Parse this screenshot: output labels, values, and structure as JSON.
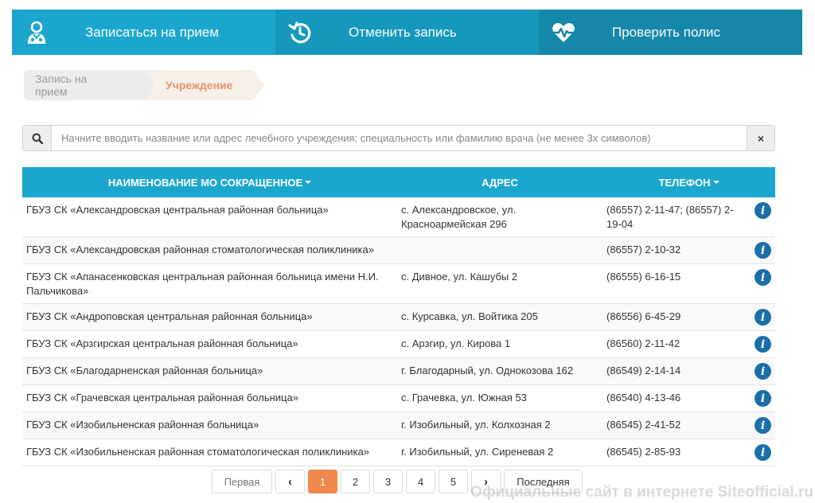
{
  "nav": {
    "tabs": [
      {
        "label": "Записаться на прием",
        "icon": "doctor-icon"
      },
      {
        "label": "Отменить запись",
        "icon": "undo-clock-icon"
      },
      {
        "label": "Проверить полис",
        "icon": "heart-pulse-icon"
      }
    ]
  },
  "breadcrumb": {
    "step1": "Запись на прием",
    "step2": "Учреждение"
  },
  "search": {
    "placeholder": "Начните вводить название или адрес лечебного учреждения; специальность или фамилию врача (не менее 3х символов)",
    "clear_label": "×"
  },
  "table": {
    "headers": {
      "name": "НАИМЕНОВАНИЕ МО СОКРАЩЕННОЕ",
      "address": "АДРЕС",
      "phone": "ТЕЛЕФОН"
    },
    "rows": [
      {
        "name": "ГБУЗ СК «Александровская центральная районная больница»",
        "address": "с. Александровское, ул. Красноармейская 296",
        "phone": "(86557) 2-11-47; (86557) 2-19-04"
      },
      {
        "name": "ГБУЗ СК «Александровская районная стоматологическая поликлиника»",
        "address": "",
        "phone": "(86557) 2-10-32"
      },
      {
        "name": "ГБУЗ СК «Апанасенковская центральная районная больница имени Н.И. Пальчикова»",
        "address": "с. Дивное, ул. Кашубы 2",
        "phone": "(86555) 6-16-15"
      },
      {
        "name": "ГБУЗ СК «Андроповская центральная районная больница»",
        "address": "с. Курсавка, ул. Войтика 205",
        "phone": "(86556) 6-45-29"
      },
      {
        "name": "ГБУЗ СК «Арзгирская центральная районная больница»",
        "address": "с. Арзгир, ул. Кирова 1",
        "phone": "(86560) 2-11-42"
      },
      {
        "name": "ГБУЗ СК «Благодарненская районная больница»",
        "address": "г. Благодарный, ул. Однокозова 162",
        "phone": "(86549) 2-14-14"
      },
      {
        "name": "ГБУЗ СК «Грачевская центральная районная больница»",
        "address": "с. Грачевка, ул. Южная 53",
        "phone": "(86540) 4-13-46"
      },
      {
        "name": "ГБУЗ СК «Изобильненская районная больница»",
        "address": "г. Изобильный, ул. Колхозная 2",
        "phone": "(86545) 2-41-52"
      },
      {
        "name": "ГБУЗ СК «Изобильненская районная стоматологическая поликлиника»",
        "address": "г. Изобильный, ул. Сиреневая 2",
        "phone": "(86545) 2-85-93"
      }
    ],
    "info_glyph": "i"
  },
  "pagination": {
    "first": "Первая",
    "prev": "‹",
    "pages": [
      "1",
      "2",
      "3",
      "4",
      "5"
    ],
    "active_page": "1",
    "next": "›",
    "last": "Последняя"
  },
  "watermark": "Официальные сайт в интернете Siteofficial.ru",
  "colors": {
    "accent": "#1ba7cd",
    "active_page": "#f0884d",
    "info_icon": "#1a6fa8"
  }
}
